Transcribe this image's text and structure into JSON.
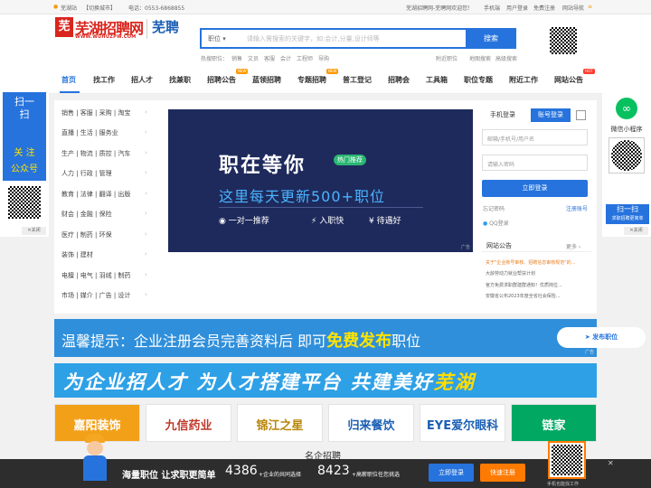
{
  "topbar": {
    "city": "芜湖站",
    "switch": "【切换城市】",
    "phone": "电话：0553-6868855",
    "welcome": "芜湖招聘网-芜聘网欢迎您！",
    "mobile": "手机端",
    "user_login": "用户登录",
    "register": "免费注册",
    "sitenav": "网站导航"
  },
  "logo": {
    "mark": "芜",
    "name": "芜湖招聘网",
    "url": "WWW.WUHUZPW.COM",
    "sub": "芜聘"
  },
  "search": {
    "position_label": "职位",
    "placeholder": "请输入需搜索的关键字，如:会计,分量,设计师等",
    "button": "搜索"
  },
  "hot": {
    "label": "热搜职位：",
    "items": [
      "销售",
      "文员",
      "客服",
      "会计",
      "工程师",
      "导购"
    ]
  },
  "header_links": {
    "map": "附近职位",
    "area": "地图搜索",
    "advanced": "高级搜索"
  },
  "nav": [
    "首页",
    "找工作",
    "招人才",
    "找兼职",
    "招聘公告",
    "蓝领招聘",
    "专题招聘",
    "普工登记",
    "招聘会",
    "工具箱",
    "职位专题",
    "附近工作",
    "网站公告"
  ],
  "nav_badges": {
    "new": "NEW",
    "hot": "HOT"
  },
  "categories": [
    "销售 | 客服 | 采购 | 淘宝",
    "直播 | 生活 | 服务业",
    "生产 | 物流 | 质控 | 汽车",
    "人力 | 行政 | 管理",
    "教育 | 法律 | 翻译 | 出版",
    "财会 | 金融 | 保险",
    "医疗 | 制药 | 环保",
    "装饰 | 建材",
    "电檀 | 电气 | 羽绒 | 制药",
    "市场 | 媒介 | 广告 | 设计"
  ],
  "banner": {
    "title": "职在等你",
    "tag": "热门推荐",
    "subtitle": "这里每天更新500+职位",
    "features": [
      "一对一推荐",
      "入职快",
      "待遇好"
    ],
    "ad": "广告"
  },
  "login": {
    "tab_mobile": "手机登录",
    "tab_account": "账号登录",
    "account_ph": "邮箱/手机号/用户名",
    "password_ph": "请输入密码",
    "button": "立即登录",
    "forgot": "忘记密码",
    "register": "注册账号",
    "qq": "QQ登录"
  },
  "notice": {
    "title": "网站公告",
    "more": "更多",
    "items": [
      "关于\"企业账号审核、招聘信息审核规范\"的...",
      "大龄劳动力就业帮扶计划",
      "官方免费求职群建群通知！优质岗位...",
      "安徽省公布2023年度全省社会保险..."
    ]
  },
  "tips": {
    "text": "温馨提示：企业注册会员完善资料后  即可",
    "highlight": "免费发布",
    "tail": "职位",
    "button": "发布职位",
    "ad": "广告"
  },
  "slogan": {
    "a": "为企业招人才  为人才搭建平台  共建美好",
    "b": "芜湖"
  },
  "company_logos": [
    "嘉阳装饰",
    "九信药业",
    "锦江之星",
    "归来餐饮",
    "EYE爱尔眼科",
    "链家"
  ],
  "section_title": "名企招聘",
  "sidebar_left": {
    "top": "扫一扫",
    "follow": "关 注",
    "account": "公众号",
    "close": "关闭"
  },
  "sidebar_right": {
    "mini": "微信小程序",
    "scan": "扫一扫",
    "desc": "求职招聘更简单",
    "close": "关闭"
  },
  "bottom": {
    "slogan": "海量职位 让求职更简单",
    "companies": "4386",
    "companies_label": "+企业的共同选择",
    "jobs": "8423",
    "jobs_label": "+高薪职位任您挑选",
    "login": "立即登录",
    "register": "快速注册",
    "qr_caption": "手机也能找工作",
    "close": "✕"
  },
  "colors": {
    "primary": "#2673dd",
    "brand_red": "#d9251d",
    "hot_badge": "#ff3b30",
    "new_badge": "#ff9900"
  }
}
